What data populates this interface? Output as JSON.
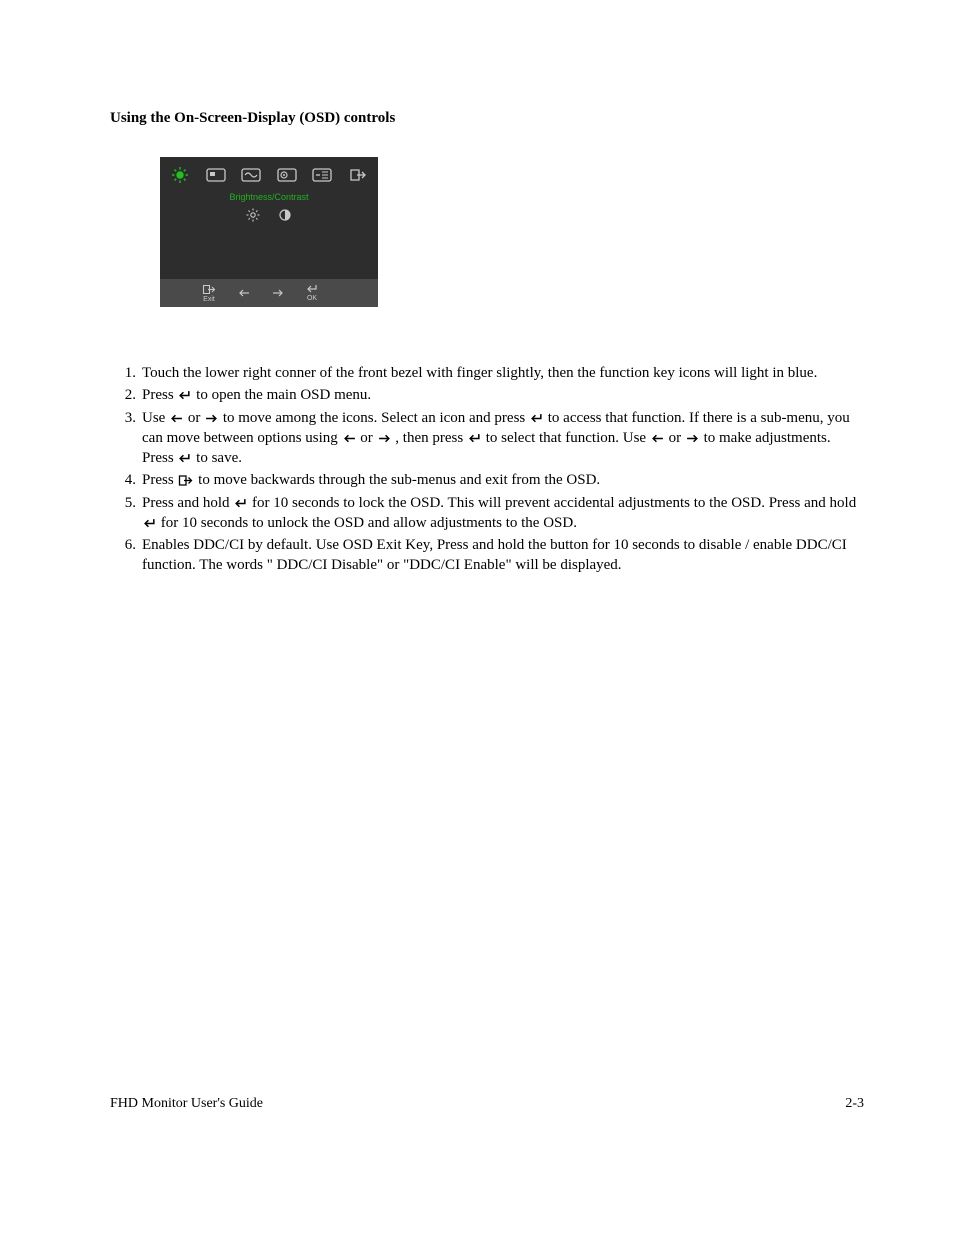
{
  "title": "Using the On-Screen-Display (OSD) controls",
  "osd": {
    "section_label": "Brightness/Contrast",
    "bottom_exit": "Exit",
    "bottom_ok": "OK"
  },
  "steps": {
    "s1": {
      "num": "1.",
      "text": "Touch the lower right conner of the front bezel with finger slightly, then the function key icons will light in blue."
    },
    "s2": {
      "num": "2.",
      "a": "Press ",
      "b": " to open the main OSD menu."
    },
    "s3": {
      "num": "3.",
      "a": "Use ",
      "b": " or ",
      "c": " to move among the icons. Select an icon and press ",
      "d": " to access that function. If there is a sub-menu, you can move between options using ",
      "e": " or ",
      "f": " , then press ",
      "g": " to select that function. Use ",
      "h": " or ",
      "i": " to make adjustments. Press ",
      "j": " to save."
    },
    "s4": {
      "num": "4.",
      "a": "Press ",
      "b": " to move backwards through the sub-menus and exit from the OSD."
    },
    "s5": {
      "num": "5.",
      "a": "Press and hold ",
      "b": " for 10 seconds to lock the OSD. This will prevent accidental adjustments to the OSD. Press and hold ",
      "c": " for 10 seconds to unlock the OSD and allow adjustments to the OSD."
    },
    "s6": {
      "num": "6.",
      "text": "Enables DDC/CI by default. Use OSD Exit Key, Press and hold the button for 10 seconds to disable / enable DDC/CI function. The words \" DDC/CI Disable\" or \"DDC/CI Enable\" will be displayed."
    }
  },
  "footer": "FHD Monitor User's Guide",
  "page_number": "2-3"
}
